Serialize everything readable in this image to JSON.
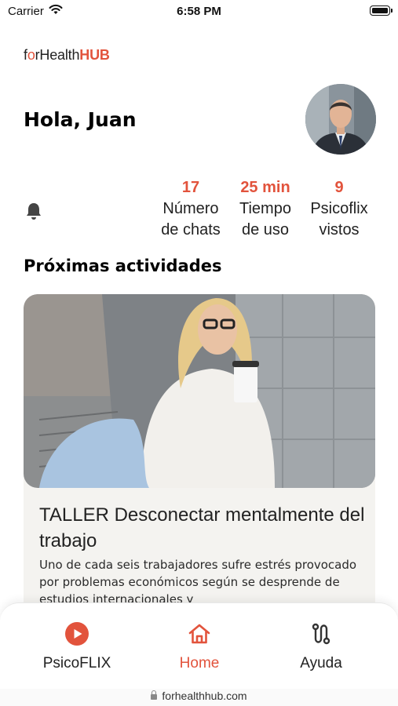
{
  "status_bar": {
    "carrier": "Carrier",
    "time": "6:58 PM"
  },
  "logo": {
    "part1": "f",
    "part2": "o",
    "part3": "rHealth",
    "part4": "HUB"
  },
  "greeting": "Hola, Juan",
  "stats": [
    {
      "value": "17",
      "line1": "Número",
      "line2": "de chats"
    },
    {
      "value": "25 min",
      "line1": "Tiempo",
      "line2": "de uso"
    },
    {
      "value": "9",
      "line1": "Psicoflix",
      "line2": "vistos"
    }
  ],
  "section_title": "Próximas actividades",
  "activity": {
    "title": "TALLER Desconectar mentalmente del trabajo",
    "description": "Uno de cada seis trabajadores sufre estrés provocado por problemas económicos según se desprende de estudios internacionales y"
  },
  "tabs": [
    {
      "label": "PsicoFLIX",
      "icon": "play-circle-icon"
    },
    {
      "label": "Home",
      "icon": "home-icon"
    },
    {
      "label": "Ayuda",
      "icon": "route-icon"
    }
  ],
  "url": "forhealthhub.com",
  "colors": {
    "accent": "#e2533c",
    "card_bg": "#f4f3f0"
  }
}
